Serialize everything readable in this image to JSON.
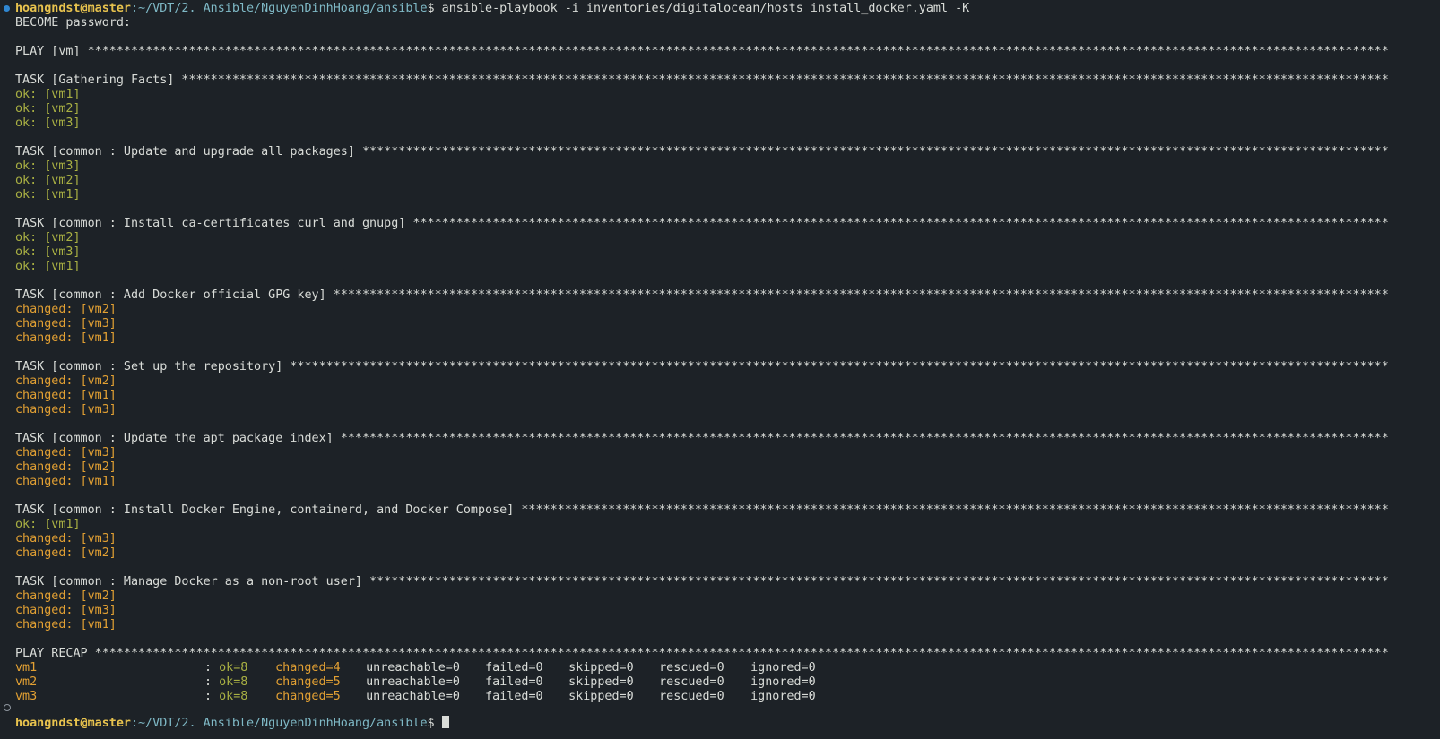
{
  "prompt": {
    "user_host": "hoangndst@master",
    "path": ":~/VDT/2. Ansible/NguyenDinhHoang/ansible",
    "symbol": "$ "
  },
  "command": "ansible-playbook -i inventories/digitalocean/hosts install_docker.yaml -K",
  "become_prompt": "BECOME password:",
  "play_header": "PLAY [vm]",
  "tasks": [
    {
      "header": "TASK [Gathering Facts]",
      "results": [
        {
          "status": "ok",
          "text": "ok: [vm1]"
        },
        {
          "status": "ok",
          "text": "ok: [vm2]"
        },
        {
          "status": "ok",
          "text": "ok: [vm3]"
        }
      ]
    },
    {
      "header": "TASK [common : Update and upgrade all packages]",
      "results": [
        {
          "status": "ok",
          "text": "ok: [vm3]"
        },
        {
          "status": "ok",
          "text": "ok: [vm2]"
        },
        {
          "status": "ok",
          "text": "ok: [vm1]"
        }
      ]
    },
    {
      "header": "TASK [common : Install ca-certificates curl and gnupg]",
      "results": [
        {
          "status": "ok",
          "text": "ok: [vm2]"
        },
        {
          "status": "ok",
          "text": "ok: [vm3]"
        },
        {
          "status": "ok",
          "text": "ok: [vm1]"
        }
      ]
    },
    {
      "header": "TASK [common : Add Docker official GPG key]",
      "results": [
        {
          "status": "changed",
          "text": "changed: [vm2]"
        },
        {
          "status": "changed",
          "text": "changed: [vm3]"
        },
        {
          "status": "changed",
          "text": "changed: [vm1]"
        }
      ]
    },
    {
      "header": "TASK [common : Set up the repository]",
      "results": [
        {
          "status": "changed",
          "text": "changed: [vm2]"
        },
        {
          "status": "changed",
          "text": "changed: [vm1]"
        },
        {
          "status": "changed",
          "text": "changed: [vm3]"
        }
      ]
    },
    {
      "header": "TASK [common : Update the apt package index]",
      "results": [
        {
          "status": "changed",
          "text": "changed: [vm3]"
        },
        {
          "status": "changed",
          "text": "changed: [vm2]"
        },
        {
          "status": "changed",
          "text": "changed: [vm1]"
        }
      ]
    },
    {
      "header": "TASK [common : Install Docker Engine, containerd, and Docker Compose]",
      "results": [
        {
          "status": "ok",
          "text": "ok: [vm1]"
        },
        {
          "status": "changed",
          "text": "changed: [vm3]"
        },
        {
          "status": "changed",
          "text": "changed: [vm2]"
        }
      ]
    },
    {
      "header": "TASK [common : Manage Docker as a non-root user]",
      "results": [
        {
          "status": "changed",
          "text": "changed: [vm2]"
        },
        {
          "status": "changed",
          "text": "changed: [vm3]"
        },
        {
          "status": "changed",
          "text": "changed: [vm1]"
        }
      ]
    }
  ],
  "recap_header": "PLAY RECAP",
  "recap": [
    {
      "host": "vm1",
      "ok": "ok=8",
      "changed": "changed=4",
      "unreachable": "unreachable=0",
      "failed": "failed=0",
      "skipped": "skipped=0",
      "rescued": "rescued=0",
      "ignored": "ignored=0"
    },
    {
      "host": "vm2",
      "ok": "ok=8",
      "changed": "changed=5",
      "unreachable": "unreachable=0",
      "failed": "failed=0",
      "skipped": "skipped=0",
      "rescued": "rescued=0",
      "ignored": "ignored=0"
    },
    {
      "host": "vm3",
      "ok": "ok=8",
      "changed": "changed=5",
      "unreachable": "unreachable=0",
      "failed": "failed=0",
      "skipped": "skipped=0",
      "rescued": "rescued=0",
      "ignored": "ignored=0"
    }
  ],
  "colors": {
    "background": "#1d2227",
    "user_host": "#e8c34e",
    "path": "#7fb9c6",
    "ok": "#a9b043",
    "changed": "#e2a033",
    "text": "#d9dcd8",
    "marker_success": "#2f86d0"
  },
  "icons": {
    "first_prompt_marker": "command-success-dot-icon",
    "last_prompt_marker": "command-pending-circle-icon"
  }
}
